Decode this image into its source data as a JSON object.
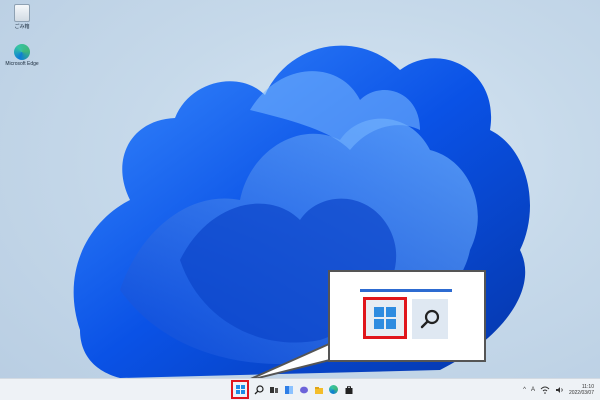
{
  "desktop": {
    "icons": [
      {
        "label": "ごみ箱",
        "icon": "recycle-bin-icon"
      },
      {
        "label": "Microsoft Edge",
        "icon": "edge-icon"
      }
    ]
  },
  "taskbar": {
    "icons": [
      "start-icon",
      "search-icon",
      "task-view-icon",
      "widgets-icon",
      "chat-icon",
      "file-explorer-icon",
      "edge-icon",
      "store-icon"
    ],
    "tray": {
      "chevron": "^",
      "ime": "A",
      "time": "11:10",
      "date": "2022/03/07"
    }
  },
  "callout": {
    "highlight_color": "#e0161c"
  }
}
